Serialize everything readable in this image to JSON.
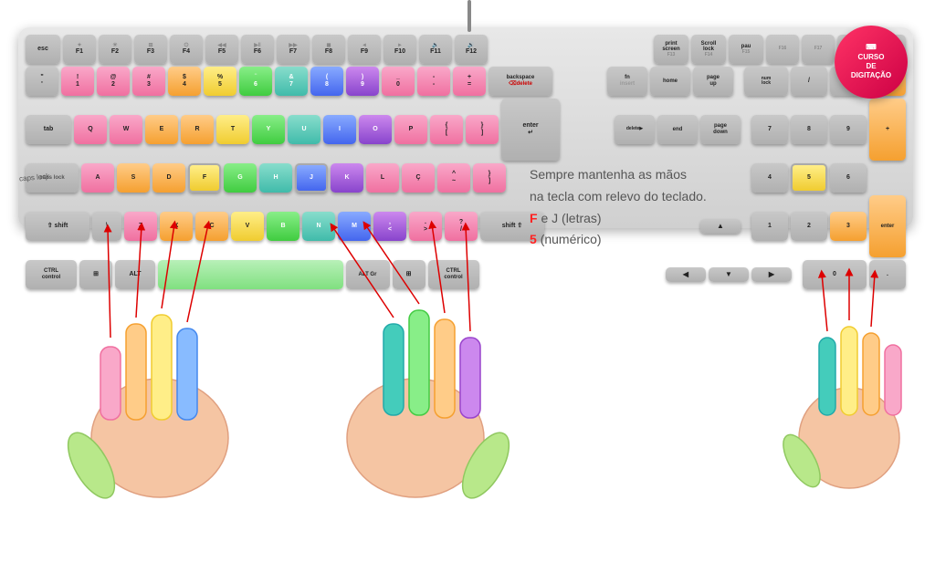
{
  "badge": {
    "line1": "CURSO",
    "line2": "DE",
    "line3": "DIGITAÇÃO"
  },
  "info": {
    "line1": "Sempre mantenha as mãos",
    "line2": "na tecla com relevo do teclado.",
    "line3_prefix": "F",
    "line3_middle": " e ",
    "line3_j": "J",
    "line3_suffix": " (letras)",
    "line4_prefix": "5",
    "line4_suffix": " (numérico)"
  },
  "caps_lock_label": "caps lock"
}
